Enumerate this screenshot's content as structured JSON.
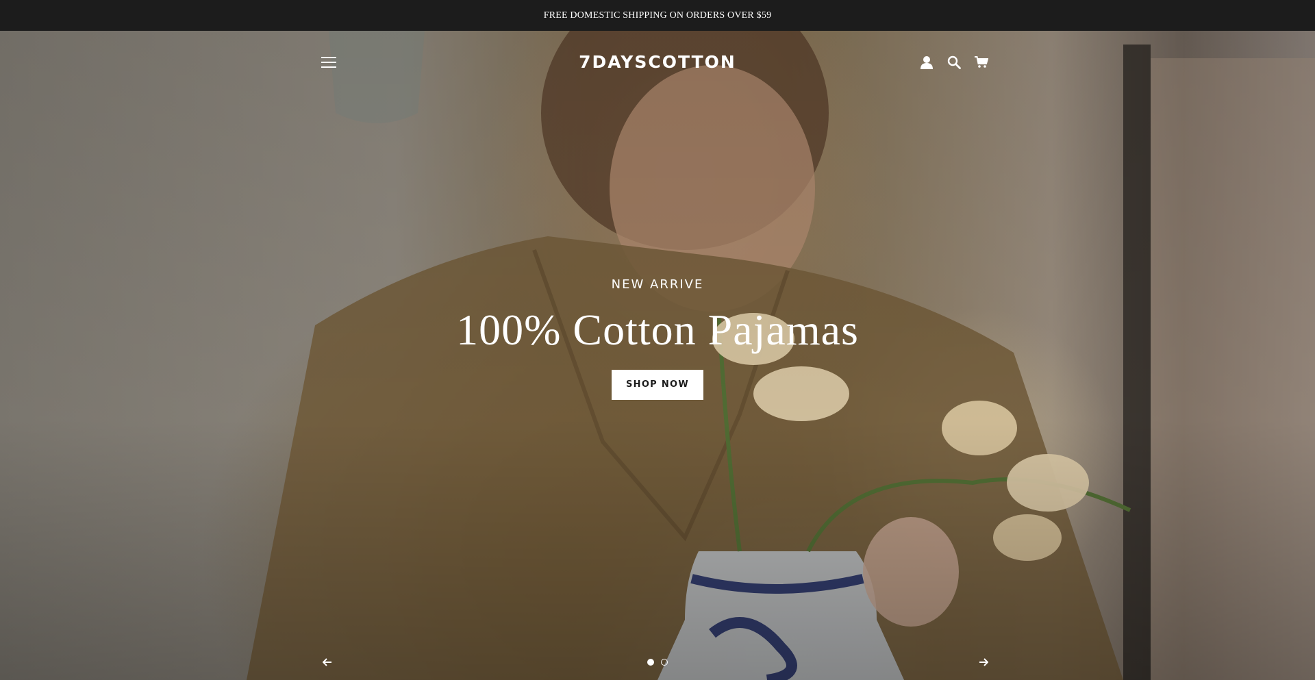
{
  "announcement": {
    "text": "FREE DOMESTIC SHIPPING ON ORDERS OVER $59"
  },
  "header": {
    "logo": "7DAYSCOTTON",
    "icons": [
      "menu-icon",
      "account-icon",
      "search-icon",
      "cart-icon"
    ]
  },
  "hero": {
    "eyebrow": "NEW ARRIVE",
    "headline": "100% Cotton Pajamas",
    "cta_label": "SHOP NOW"
  },
  "slider": {
    "slide_count": 2,
    "active_slide": 1
  },
  "colors": {
    "announcement_bg": "#1c1c1c",
    "text_light": "#ffffff",
    "button_bg": "#ffffff",
    "button_text": "#1c1c1c"
  }
}
